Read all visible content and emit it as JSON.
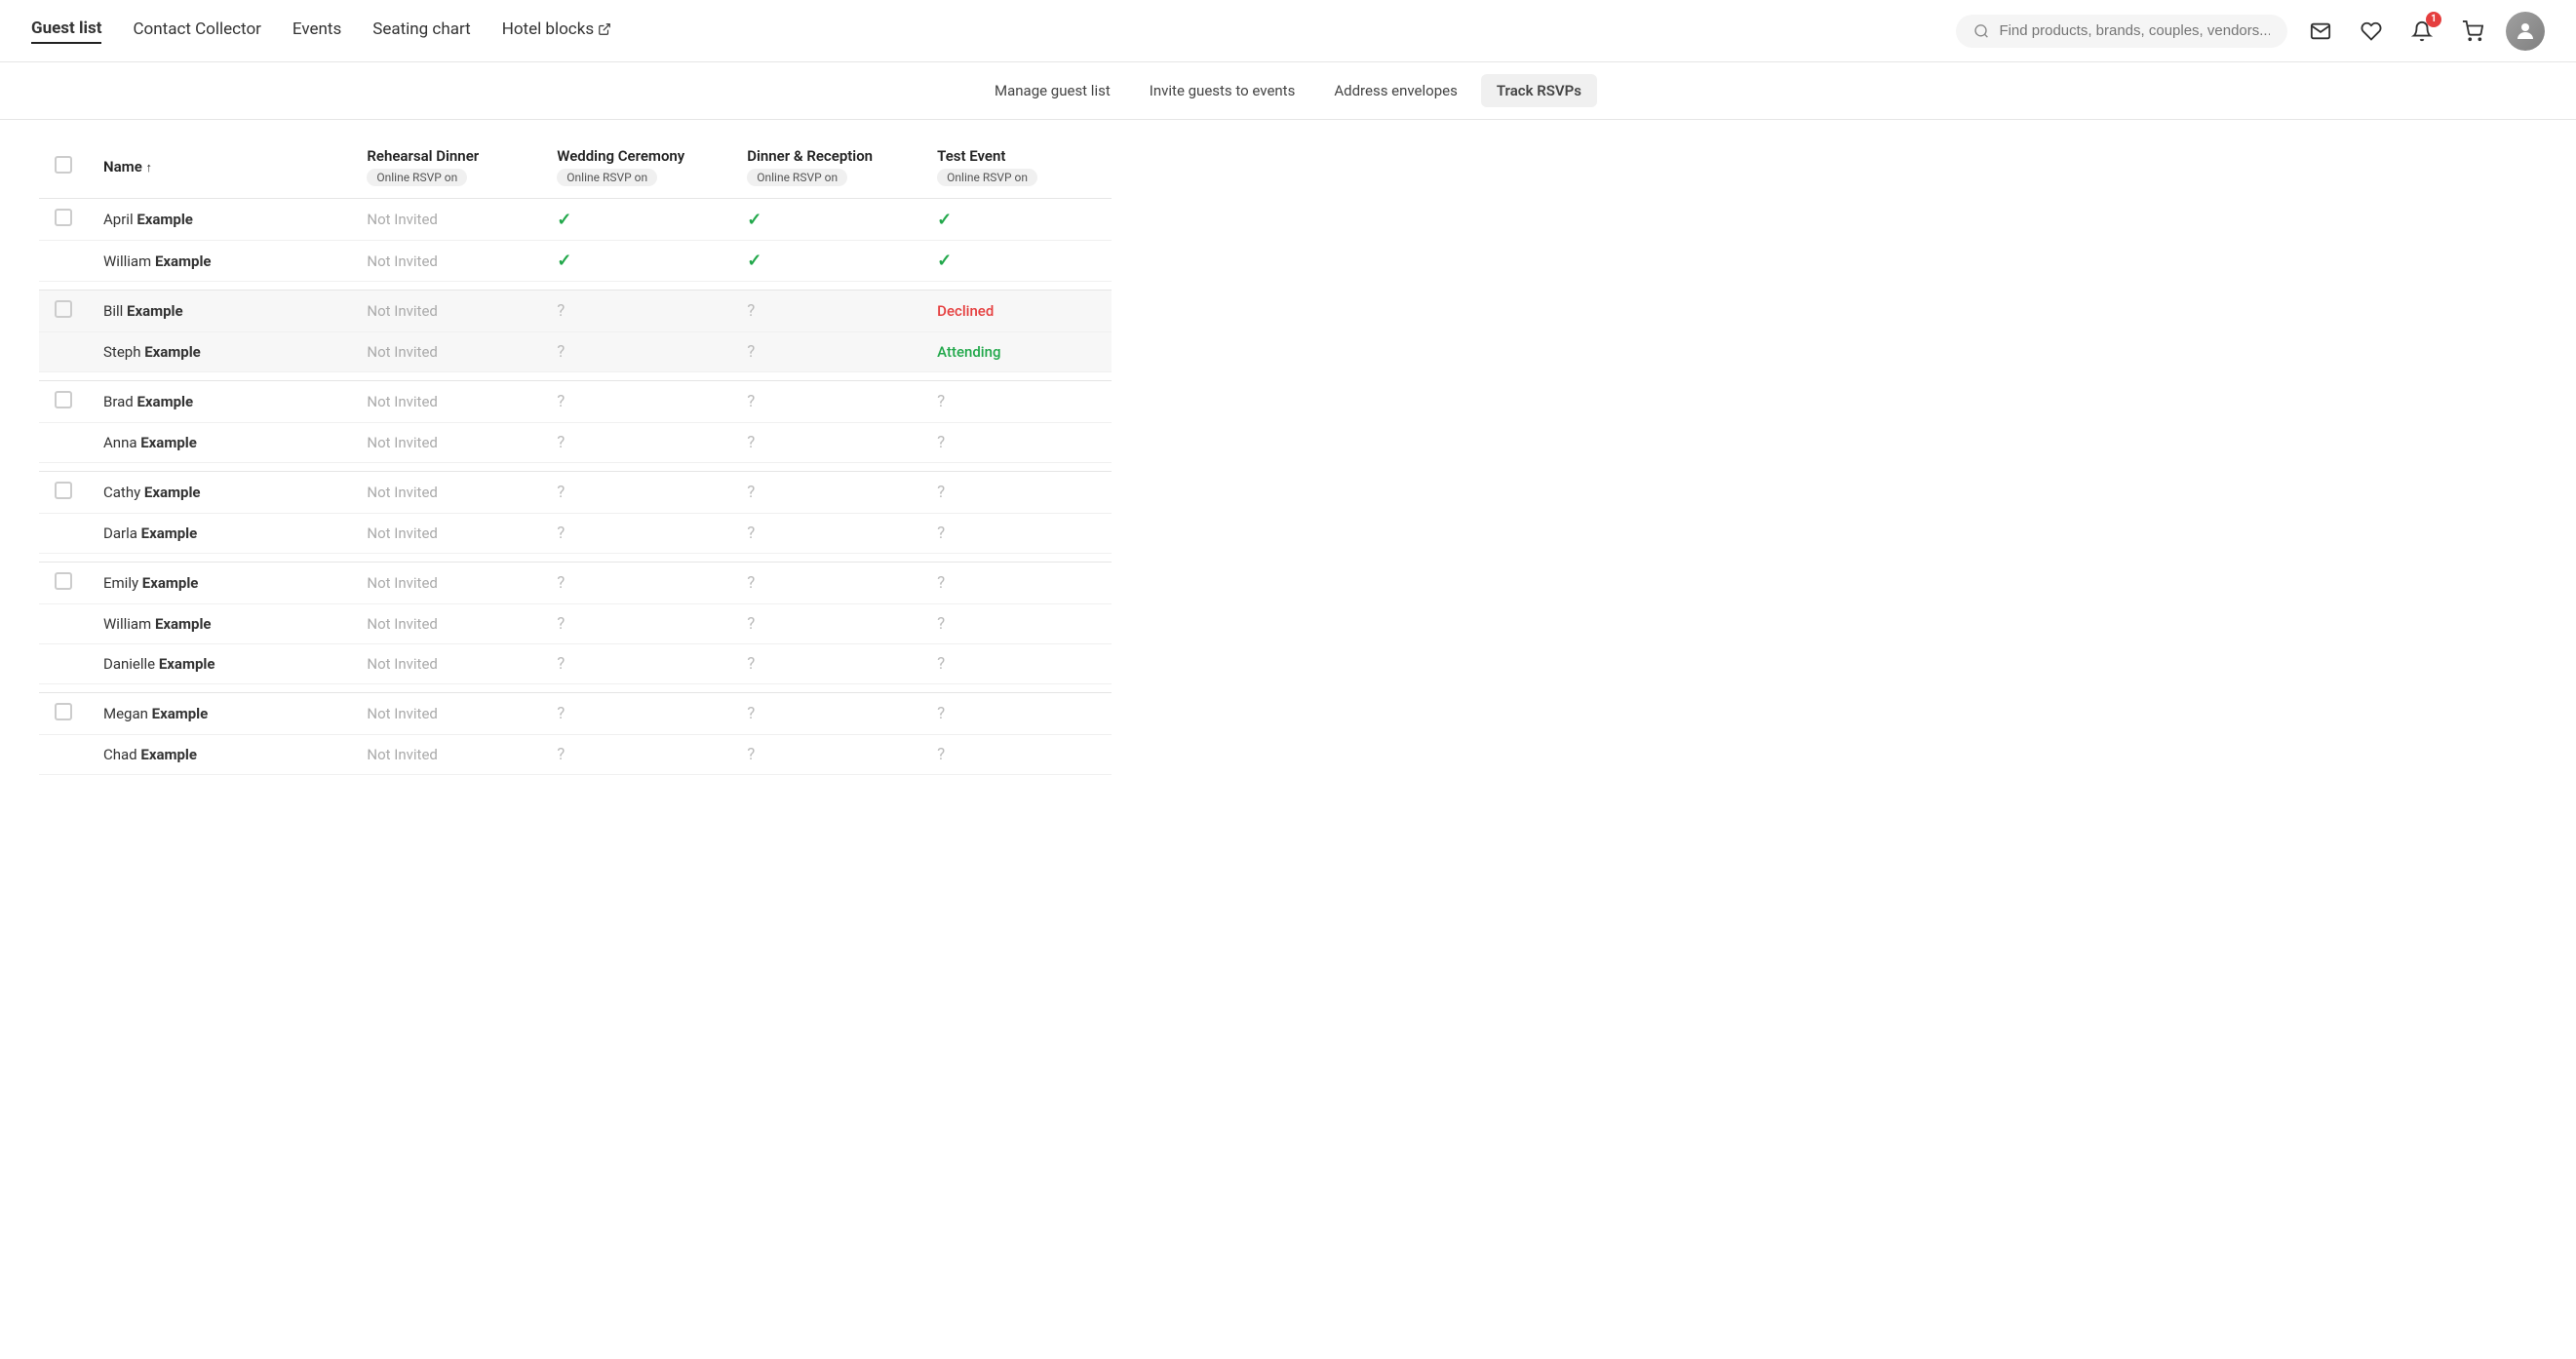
{
  "nav": {
    "items": [
      {
        "label": "Guest list",
        "active": true
      },
      {
        "label": "Contact Collector",
        "active": false
      },
      {
        "label": "Events",
        "active": false
      },
      {
        "label": "Seating chart",
        "active": false
      },
      {
        "label": "Hotel blocks",
        "active": false,
        "external": true
      }
    ],
    "search_placeholder": "Find products, brands, couples, vendors...",
    "notification_count": "1"
  },
  "sub_nav": {
    "items": [
      {
        "label": "Manage guest list",
        "active": false
      },
      {
        "label": "Invite guests to events",
        "active": false
      },
      {
        "label": "Address envelopes",
        "active": false
      },
      {
        "label": "Track RSVPs",
        "active": true
      }
    ]
  },
  "table": {
    "columns": [
      {
        "label": "Name",
        "sort": "↑"
      },
      {
        "label": "Rehearsal Dinner",
        "badge": "Online RSVP on"
      },
      {
        "label": "Wedding Ceremony",
        "badge": "Online RSVP on"
      },
      {
        "label": "Dinner & Reception",
        "badge": "Online RSVP on"
      },
      {
        "label": "Test Event",
        "badge": "Online RSVP on"
      }
    ],
    "groups": [
      {
        "shaded": false,
        "members": [
          {
            "first": "April",
            "last": "Example",
            "events": [
              "not_invited",
              "check",
              "check",
              "check"
            ]
          },
          {
            "first": "William",
            "last": "Example",
            "events": [
              "not_invited",
              "check",
              "check",
              "check"
            ]
          }
        ]
      },
      {
        "shaded": true,
        "members": [
          {
            "first": "Bill",
            "last": "Example",
            "events": [
              "not_invited",
              "question",
              "question",
              "declined"
            ]
          },
          {
            "first": "Steph",
            "last": "Example",
            "events": [
              "not_invited",
              "question",
              "question",
              "attending"
            ]
          }
        ]
      },
      {
        "shaded": false,
        "members": [
          {
            "first": "Brad",
            "last": "Example",
            "events": [
              "not_invited",
              "question",
              "question",
              "question"
            ]
          },
          {
            "first": "Anna",
            "last": "Example",
            "events": [
              "not_invited",
              "question",
              "question",
              "question"
            ]
          }
        ]
      },
      {
        "shaded": false,
        "members": [
          {
            "first": "Cathy",
            "last": "Example",
            "events": [
              "not_invited",
              "question",
              "question",
              "question"
            ]
          },
          {
            "first": "Darla",
            "last": "Example",
            "events": [
              "not_invited",
              "question",
              "question",
              "question"
            ]
          }
        ]
      },
      {
        "shaded": false,
        "members": [
          {
            "first": "Emily",
            "last": "Example",
            "events": [
              "not_invited",
              "question",
              "question",
              "question"
            ]
          },
          {
            "first": "William",
            "last": "Example",
            "events": [
              "not_invited",
              "question",
              "question",
              "question"
            ]
          },
          {
            "first": "Danielle",
            "last": "Example",
            "events": [
              "not_invited",
              "question",
              "question",
              "question"
            ]
          }
        ]
      },
      {
        "shaded": false,
        "members": [
          {
            "first": "Megan",
            "last": "Example",
            "events": [
              "not_invited",
              "question",
              "question",
              "question"
            ]
          },
          {
            "first": "Chad",
            "last": "Example",
            "events": [
              "not_invited",
              "question",
              "question",
              "question"
            ]
          }
        ]
      }
    ],
    "status_labels": {
      "not_invited": "Not Invited",
      "check": "✓",
      "question": "?",
      "declined": "Declined",
      "attending": "Attending"
    }
  }
}
